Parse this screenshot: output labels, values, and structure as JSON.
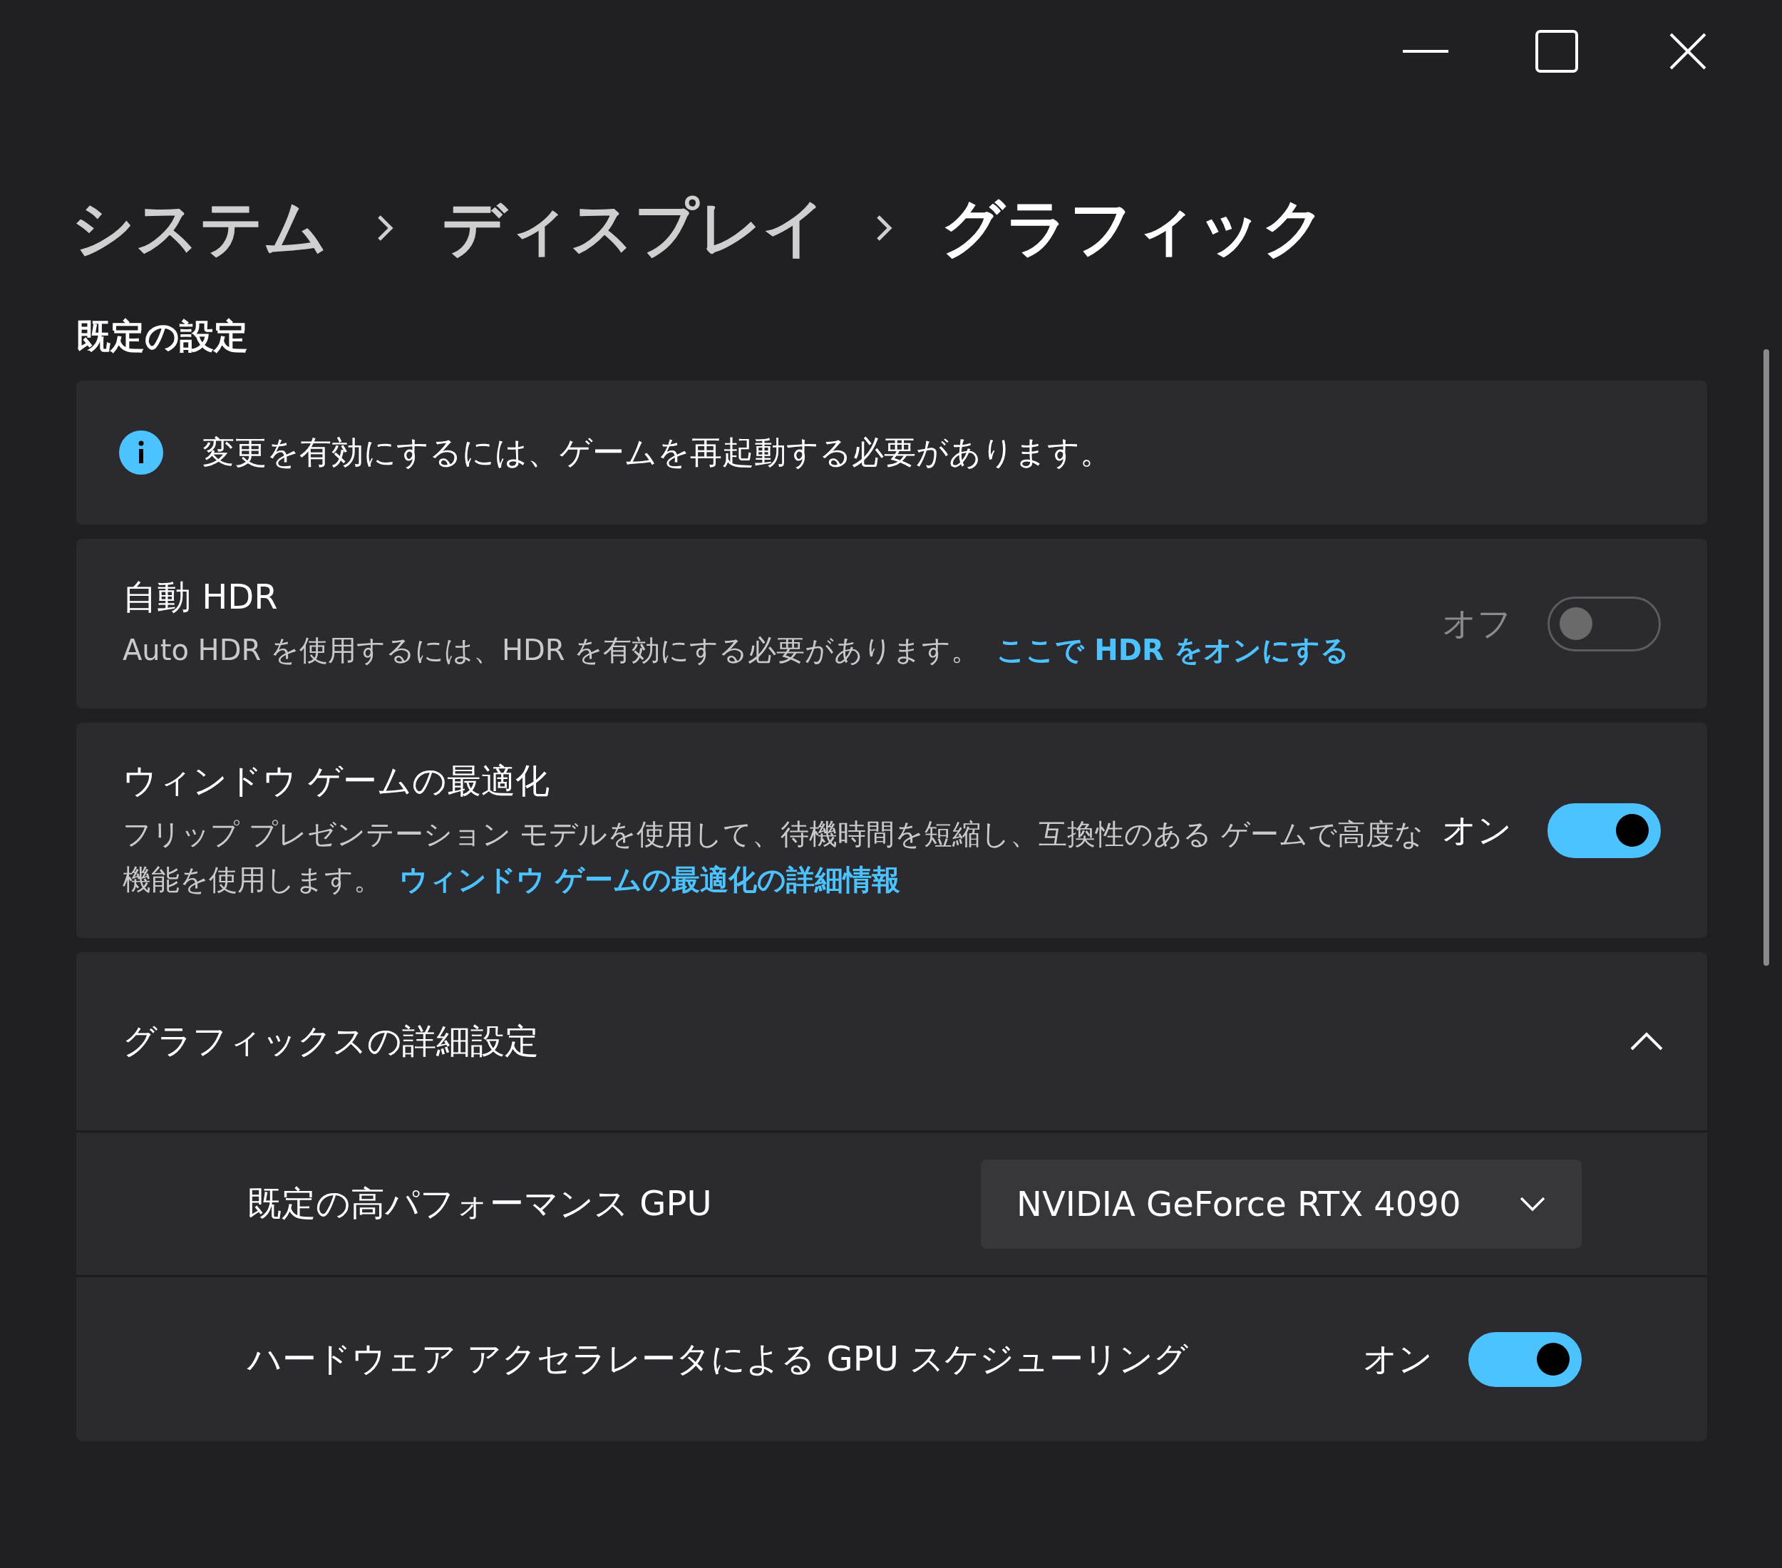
{
  "breadcrumb": [
    {
      "label": "システム",
      "current": false
    },
    {
      "label": "ディスプレイ",
      "current": false
    },
    {
      "label": "グラフィック",
      "current": true
    }
  ],
  "section_title": "既定の設定",
  "info_bar": {
    "text": "変更を有効にするには、ゲームを再起動する必要があります。"
  },
  "settings": [
    {
      "title": "自動 HDR",
      "description": "Auto HDR を使用するには、HDR を有効にする必要があります。",
      "link": "ここで HDR をオンにする",
      "state_label": "オフ",
      "on": false,
      "disabled": true
    },
    {
      "title": "ウィンドウ ゲームの最適化",
      "description": "フリップ プレゼンテーション モデルを使用して、待機時間を短縮し、互換性のある ゲームで高度な機能を使用します。",
      "link": "ウィンドウ ゲームの最適化の詳細情報",
      "state_label": "オン",
      "on": true,
      "disabled": false
    }
  ],
  "expander": {
    "title": "グラフィックスの詳細設定",
    "expanded": true,
    "rows": [
      {
        "kind": "dropdown",
        "label": "既定の高パフォーマンス GPU",
        "value": "NVIDIA GeForce RTX 4090"
      },
      {
        "kind": "toggle",
        "label": "ハードウェア アクセラレータによる GPU スケジューリング",
        "state_label": "オン",
        "on": true
      }
    ]
  }
}
